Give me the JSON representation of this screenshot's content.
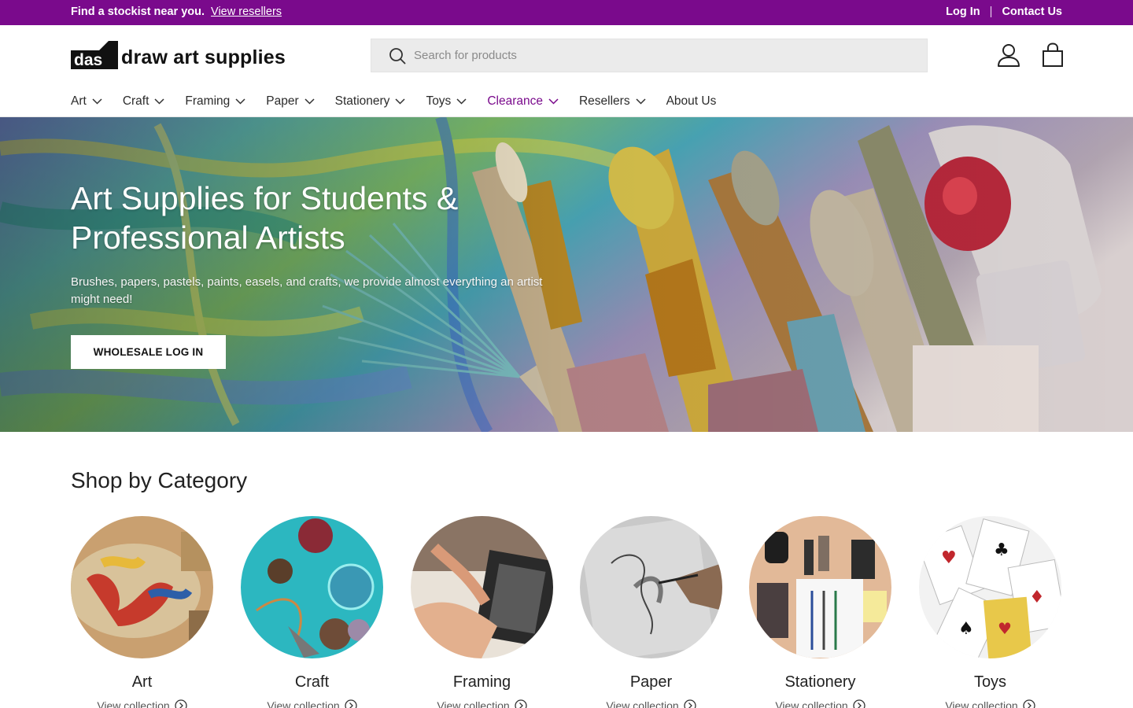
{
  "announcement": {
    "text": "Find a stockist near you.",
    "link": "View resellers",
    "login": "Log In",
    "separator": "|",
    "contact": "Contact Us",
    "bg_color": "#7a0a8c"
  },
  "header": {
    "logo_mark": "das",
    "logo_text": "draw art supplies",
    "search_placeholder": "Search for products",
    "icons": [
      "search-icon",
      "account-icon",
      "cart-icon"
    ]
  },
  "nav": {
    "items": [
      {
        "label": "Art",
        "has_dropdown": true
      },
      {
        "label": "Craft",
        "has_dropdown": true
      },
      {
        "label": "Framing",
        "has_dropdown": true
      },
      {
        "label": "Paper",
        "has_dropdown": true
      },
      {
        "label": "Stationery",
        "has_dropdown": true
      },
      {
        "label": "Toys",
        "has_dropdown": true
      },
      {
        "label": "Clearance",
        "has_dropdown": true
      },
      {
        "label": "Resellers",
        "has_dropdown": true
      },
      {
        "label": "About Us",
        "has_dropdown": false
      }
    ],
    "accent_color": "#7a0a8c"
  },
  "hero": {
    "title": "Art Supplies for Students & Professional Artists",
    "subtitle": "Brushes, papers, pastels, paints, easels, and crafts, we provide almost everything an artist might need!",
    "button": "WHOLESALE LOG IN"
  },
  "categories": {
    "title": "Shop by Category",
    "items": [
      {
        "name": "Art",
        "link": "View collection"
      },
      {
        "name": "Craft",
        "link": "View collection"
      },
      {
        "name": "Framing",
        "link": "View collection"
      },
      {
        "name": "Paper",
        "link": "View collection"
      },
      {
        "name": "Stationery",
        "link": "View collection"
      },
      {
        "name": "Toys",
        "link": "View collection"
      }
    ]
  }
}
